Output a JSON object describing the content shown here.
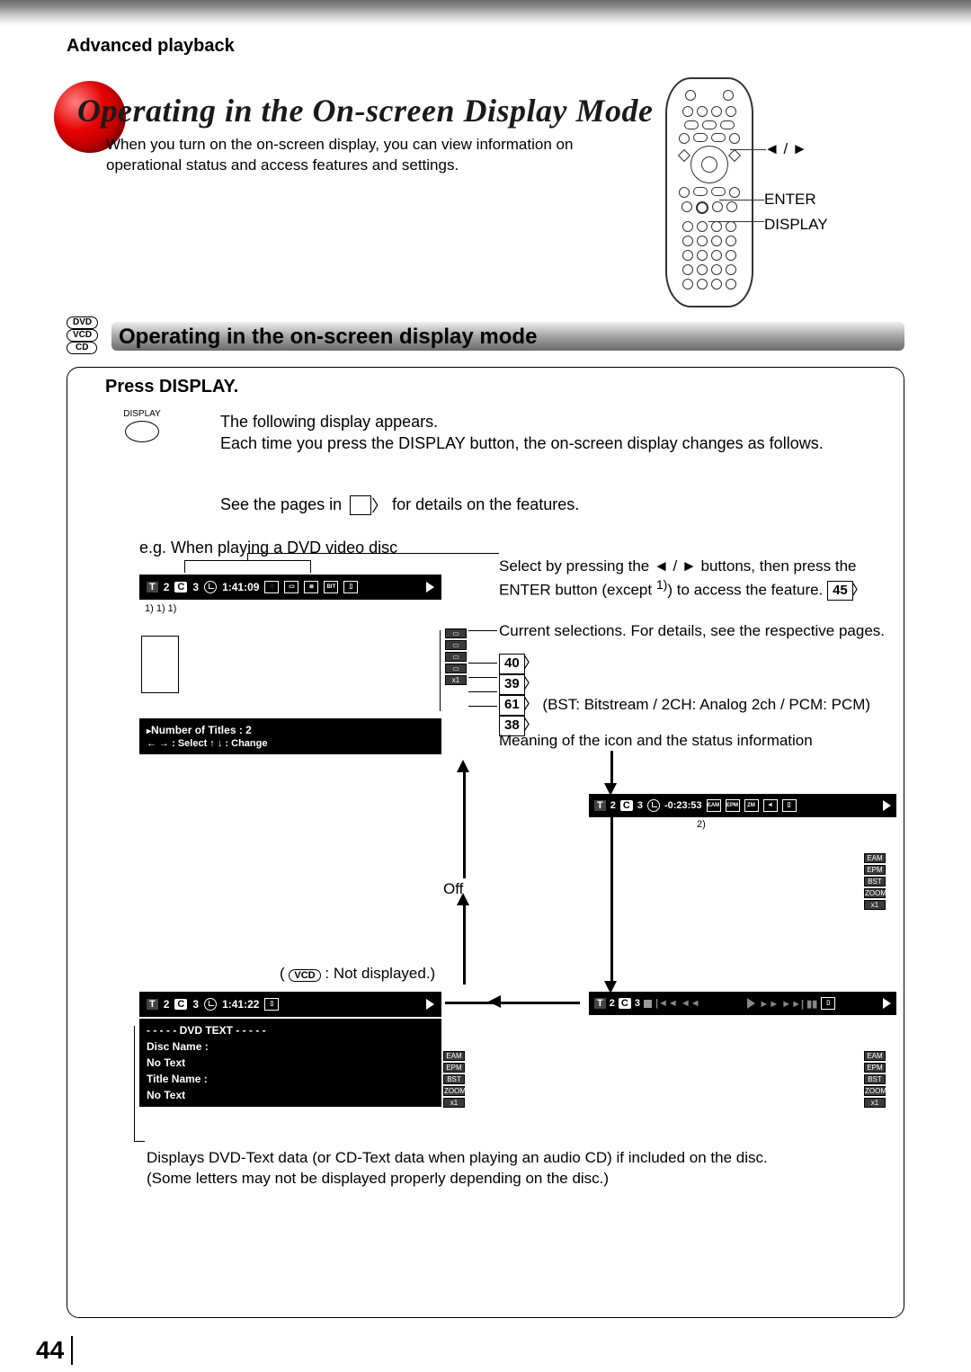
{
  "header": {
    "crumb": "Advanced playback"
  },
  "title": "Operating in the On-screen Display Mode",
  "subdesc": "When you turn on the on-screen display, you can view information on operational status and access features and settings.",
  "remote_labels": {
    "arrows": "◄ / ►",
    "enter": "ENTER",
    "display": "DISPLAY"
  },
  "disc_icons": [
    "DVD",
    "VCD",
    "CD"
  ],
  "section_title": "Operating in the on-screen display mode",
  "press": "Press DISPLAY.",
  "display_button": "DISPLAY",
  "body1": "The following display appears.",
  "body2": "Each time you press the DISPLAY button, the on-screen display changes as follows.",
  "see_pages_a": "See the pages in",
  "see_pages_b": "for details on the features.",
  "eg": "e.g. When playing a DVD video disc",
  "osd1": {
    "t": "T",
    "tval": "2",
    "c": "C",
    "cval": "3",
    "time": "1:41:09"
  },
  "osd1_footnotes": "1)        1)         1)",
  "info_box": {
    "line1": "Number of Titles :     2",
    "line2": "← → : Select  ↑ ↓ : Change"
  },
  "rt1a": "Select by pressing the ◄ / ► buttons, then press the ENTER button (except ",
  "rt1_sup": "1)",
  "rt1b": ") to access the feature.",
  "rt1_page": "45",
  "rt2": "Current selections. For details, see the respective pages.",
  "pages": {
    "p1": "40",
    "p2": "39",
    "p3": "61",
    "p3_note": "(BST: Bitstream / 2CH: Analog 2ch / PCM: PCM)",
    "p4": "38"
  },
  "rt3": "Meaning of the icon and the status information",
  "osd2": {
    "t": "T",
    "tval": "2",
    "c": "C",
    "cval": "3",
    "time": "-0:23:53"
  },
  "osd2_foot": "2)",
  "off": "Off",
  "vcd_line_a": "(",
  "vcd_badge": "VCD",
  "vcd_line_b": ": Not displayed.)",
  "osd3": {
    "t": "T",
    "tval": "2",
    "c": "C",
    "cval": "3",
    "time": "1:41:22"
  },
  "dvd_text": {
    "hdr": "- - - - - DVD TEXT - - - - -",
    "l1": "Disc Name :",
    "l2": "No Text",
    "l3": "Title Name :",
    "l4": "No Text"
  },
  "osd4": {
    "t": "T",
    "tval": "2",
    "c": "C",
    "cval": "3"
  },
  "side_labels": [
    "EAM",
    "EPM",
    "BST",
    "ZOOM"
  ],
  "foot_txt1": "Displays DVD-Text data (or CD-Text data when playing an audio CD) if included on the disc.",
  "foot_txt2": "(Some letters may not be displayed properly depending on the disc.)",
  "page_number": "44"
}
